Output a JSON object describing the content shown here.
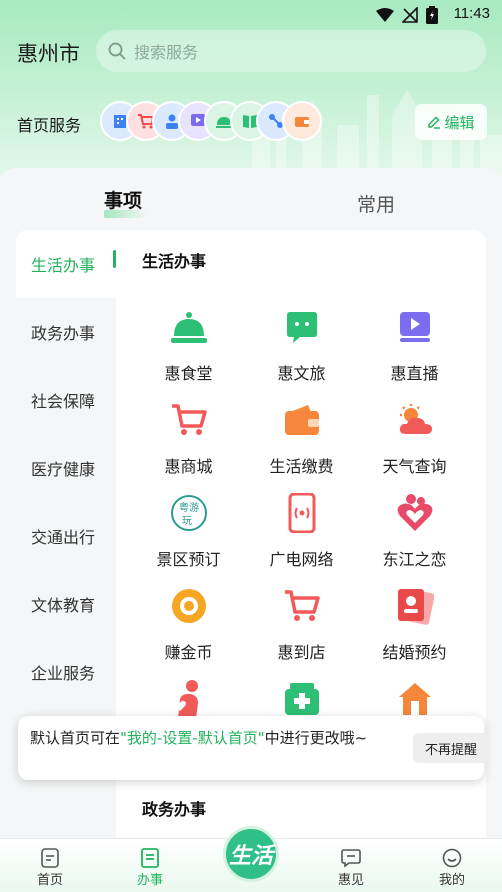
{
  "status_bar": {
    "time": "11:43"
  },
  "header": {
    "city": "惠州市",
    "search_placeholder": "搜索服务",
    "home_services_label": "首页服务",
    "edit_label": "编辑"
  },
  "tabs": {
    "items_label": "事项",
    "common_label": "常用"
  },
  "categories": [
    {
      "label": "生活办事",
      "active": true
    },
    {
      "label": "政务办事",
      "active": false
    },
    {
      "label": "社会保障",
      "active": false
    },
    {
      "label": "医疗健康",
      "active": false
    },
    {
      "label": "交通出行",
      "active": false
    },
    {
      "label": "文体教育",
      "active": false
    },
    {
      "label": "企业服务",
      "active": false
    }
  ],
  "sections": {
    "life": {
      "title": "生活办事",
      "items": [
        {
          "label": "惠食堂",
          "icon": "food-bell-icon"
        },
        {
          "label": "惠文旅",
          "icon": "chat-bubble-icon"
        },
        {
          "label": "惠直播",
          "icon": "live-play-icon"
        },
        {
          "label": "惠商城",
          "icon": "shopping-cart-icon"
        },
        {
          "label": "生活缴费",
          "icon": "wallet-icon"
        },
        {
          "label": "天气查询",
          "icon": "weather-icon"
        },
        {
          "label": "景区预订",
          "icon": "scenic-logo-icon"
        },
        {
          "label": "广电网络",
          "icon": "phone-broadcast-icon"
        },
        {
          "label": "东江之恋",
          "icon": "heart-couple-icon"
        },
        {
          "label": "赚金币",
          "icon": "coin-icon"
        },
        {
          "label": "惠到店",
          "icon": "store-cart-icon"
        },
        {
          "label": "结婚预约",
          "icon": "marriage-photo-icon"
        }
      ]
    },
    "gov": {
      "title": "政务办事"
    }
  },
  "toast": {
    "text_before": "默认首页可在",
    "text_highlight": "\"我的-设置-默认首页\"",
    "text_after": "中进行更改哦~",
    "button_label": "不再提醒"
  },
  "tabbar": {
    "home": "首页",
    "services": "办事",
    "center": "生活",
    "news": "惠见",
    "mine": "我的"
  },
  "colors": {
    "accent": "#22b35e",
    "header_green": "#a8eac1",
    "icon_green": "#2dbf74",
    "icon_purple": "#7b6cf0",
    "icon_red": "#f25a5a",
    "icon_orange": "#f5a623"
  }
}
